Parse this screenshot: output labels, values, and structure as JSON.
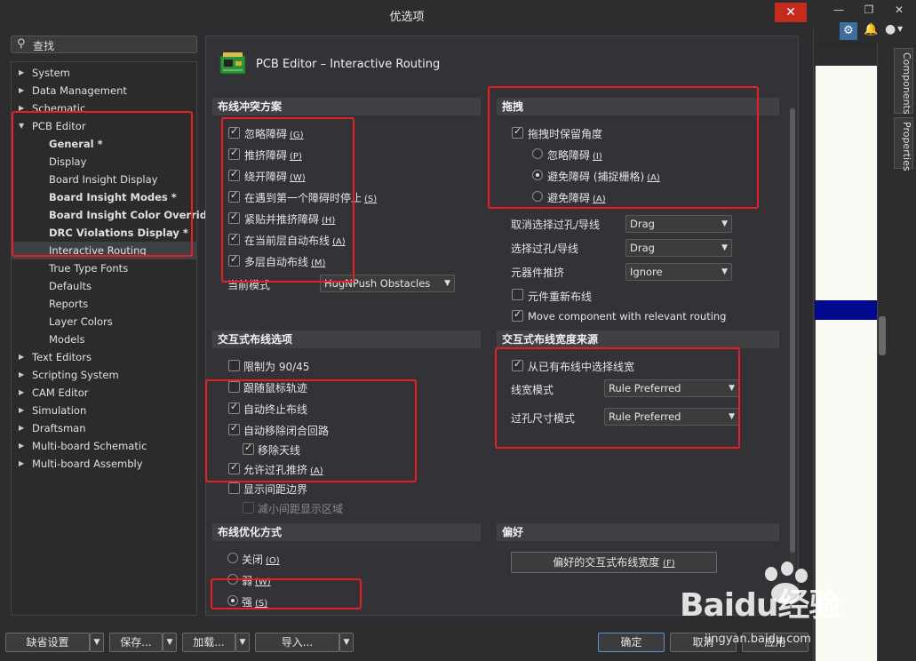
{
  "dialog": {
    "title": "优选项",
    "close_glyph": "✕"
  },
  "search": {
    "placeholder": "查找"
  },
  "tree": [
    {
      "label": "System",
      "arrow": "▶",
      "level": 0,
      "bold": false
    },
    {
      "label": "Data Management",
      "arrow": "▶",
      "level": 0,
      "bold": false
    },
    {
      "label": "Schematic",
      "arrow": "▶",
      "level": 0,
      "bold": false
    },
    {
      "label": "PCB Editor",
      "arrow": "▼",
      "level": 0,
      "bold": false
    },
    {
      "label": "General *",
      "level": 1,
      "bold": true
    },
    {
      "label": "Display",
      "level": 1,
      "bold": false
    },
    {
      "label": "Board Insight Display",
      "level": 1,
      "bold": false
    },
    {
      "label": "Board Insight Modes *",
      "level": 1,
      "bold": true
    },
    {
      "label": "Board Insight Color Overrides *",
      "level": 1,
      "bold": true
    },
    {
      "label": "DRC Violations Display *",
      "level": 1,
      "bold": true
    },
    {
      "label": "Interactive Routing",
      "level": 1,
      "bold": false,
      "selected": true
    },
    {
      "label": "True Type Fonts",
      "level": 1,
      "bold": false
    },
    {
      "label": "Defaults",
      "level": 1,
      "bold": false
    },
    {
      "label": "Reports",
      "level": 1,
      "bold": false
    },
    {
      "label": "Layer Colors",
      "level": 1,
      "bold": false
    },
    {
      "label": "Models",
      "level": 1,
      "bold": false
    },
    {
      "label": "Text Editors",
      "arrow": "▶",
      "level": 0,
      "bold": false
    },
    {
      "label": "Scripting System",
      "arrow": "▶",
      "level": 0,
      "bold": false
    },
    {
      "label": "CAM Editor",
      "arrow": "▶",
      "level": 0,
      "bold": false
    },
    {
      "label": "Simulation",
      "arrow": "▶",
      "level": 0,
      "bold": false
    },
    {
      "label": "Draftsman",
      "arrow": "▶",
      "level": 0,
      "bold": false
    },
    {
      "label": "Multi-board Schematic",
      "arrow": "▶",
      "level": 0,
      "bold": false
    },
    {
      "label": "Multi-board Assembly",
      "arrow": "▶",
      "level": 0,
      "bold": false
    }
  ],
  "page": {
    "title": "PCB Editor – Interactive Routing"
  },
  "conflict": {
    "header": "布线冲突方案",
    "options": [
      {
        "label": "忽略障碍",
        "key": "(G)",
        "checked": true
      },
      {
        "label": "推挤障碍",
        "key": "(P)",
        "checked": true
      },
      {
        "label": "绕开障碍",
        "key": "(W)",
        "checked": true
      },
      {
        "label": "在遇到第一个障碍时停止",
        "key": "(S)",
        "checked": true
      },
      {
        "label": "紧贴并推挤障碍",
        "key": "(H)",
        "checked": true
      },
      {
        "label": "在当前层自动布线",
        "key": "(A)",
        "checked": true
      },
      {
        "label": "多层自动布线",
        "key": "(M)",
        "checked": true
      }
    ],
    "mode_label": "当前模式",
    "mode_value": "HugNPush Obstacles"
  },
  "drag": {
    "header": "拖拽",
    "keep_angle": {
      "label": "拖拽时保留角度",
      "checked": true
    },
    "radios": [
      {
        "label": "忽略障碍",
        "key": "(I)",
        "selected": false
      },
      {
        "label": "避免障碍 (捕捉栅格)",
        "key": "(A)",
        "selected": true
      },
      {
        "label": "避免障碍",
        "key": "(A)",
        "selected": false
      }
    ],
    "rows": [
      {
        "label": "取消选择过孔/导线",
        "value": "Drag"
      },
      {
        "label": "选择过孔/导线",
        "value": "Drag"
      },
      {
        "label": "元器件推挤",
        "value": "Ignore"
      }
    ],
    "reroute": {
      "label": "元件重新布线",
      "checked": false
    },
    "move_component": {
      "label": "Move component with relevant routing",
      "checked": true
    }
  },
  "interactive": {
    "header": "交互式布线选项",
    "options": [
      {
        "label": "限制为 90/45",
        "key": "",
        "checked": false,
        "indent": false,
        "disabled": false
      },
      {
        "label": "跟随鼠标轨迹",
        "key": "",
        "checked": false,
        "indent": false,
        "disabled": false
      },
      {
        "label": "自动终止布线",
        "key": "",
        "checked": true,
        "indent": false,
        "disabled": false
      },
      {
        "label": "自动移除闭合回路",
        "key": "",
        "checked": true,
        "indent": false,
        "disabled": false
      },
      {
        "label": "移除天线",
        "key": "",
        "checked": true,
        "indent": true,
        "disabled": false
      },
      {
        "label": "允许过孔推挤",
        "key": "(A)",
        "checked": true,
        "indent": false,
        "disabled": false
      },
      {
        "label": "显示间距边界",
        "key": "",
        "checked": false,
        "indent": false,
        "disabled": false
      },
      {
        "label": "减小间距显示区域",
        "key": "",
        "checked": false,
        "indent": true,
        "disabled": true
      }
    ]
  },
  "width_source": {
    "header": "交互式布线宽度来源",
    "pick_existing": {
      "label": "从已有布线中选择线宽",
      "checked": true
    },
    "width_mode": {
      "label": "线宽模式",
      "value": "Rule Preferred"
    },
    "via_mode": {
      "label": "过孔尺寸模式",
      "value": "Rule Preferred"
    }
  },
  "optimize": {
    "header": "布线优化方式",
    "radios": [
      {
        "label": "关闭",
        "key": "(O)",
        "selected": false
      },
      {
        "label": "弱",
        "key": "(W)",
        "selected": false
      },
      {
        "label": "强",
        "key": "(S)",
        "selected": true
      }
    ]
  },
  "favorites": {
    "header": "偏好",
    "button": "偏好的交互式布线宽度",
    "button_key": "(F)"
  },
  "footer": {
    "defaults": "缺省设置",
    "save": "保存...",
    "load": "加载...",
    "import": "导入...",
    "ok": "确定",
    "cancel": "取消",
    "apply": "应用"
  },
  "app": {
    "tab_components": "Components",
    "tab_properties": "Properties",
    "win_min": "—",
    "win_restore": "❐",
    "win_close": "✕"
  },
  "watermark": {
    "text": "Baidu经验",
    "url": "jingyan.baidu.com"
  },
  "colors": {
    "accent_red": "#e81e25",
    "selection": "#3f3f46",
    "blue_bar": "#000a8c"
  },
  "icons": [
    "search-icon",
    "close-icon",
    "pcb-board-icon",
    "gear-icon",
    "bell-icon",
    "user-icon",
    "chevron-down-icon",
    "expand-arrow-icon"
  ]
}
